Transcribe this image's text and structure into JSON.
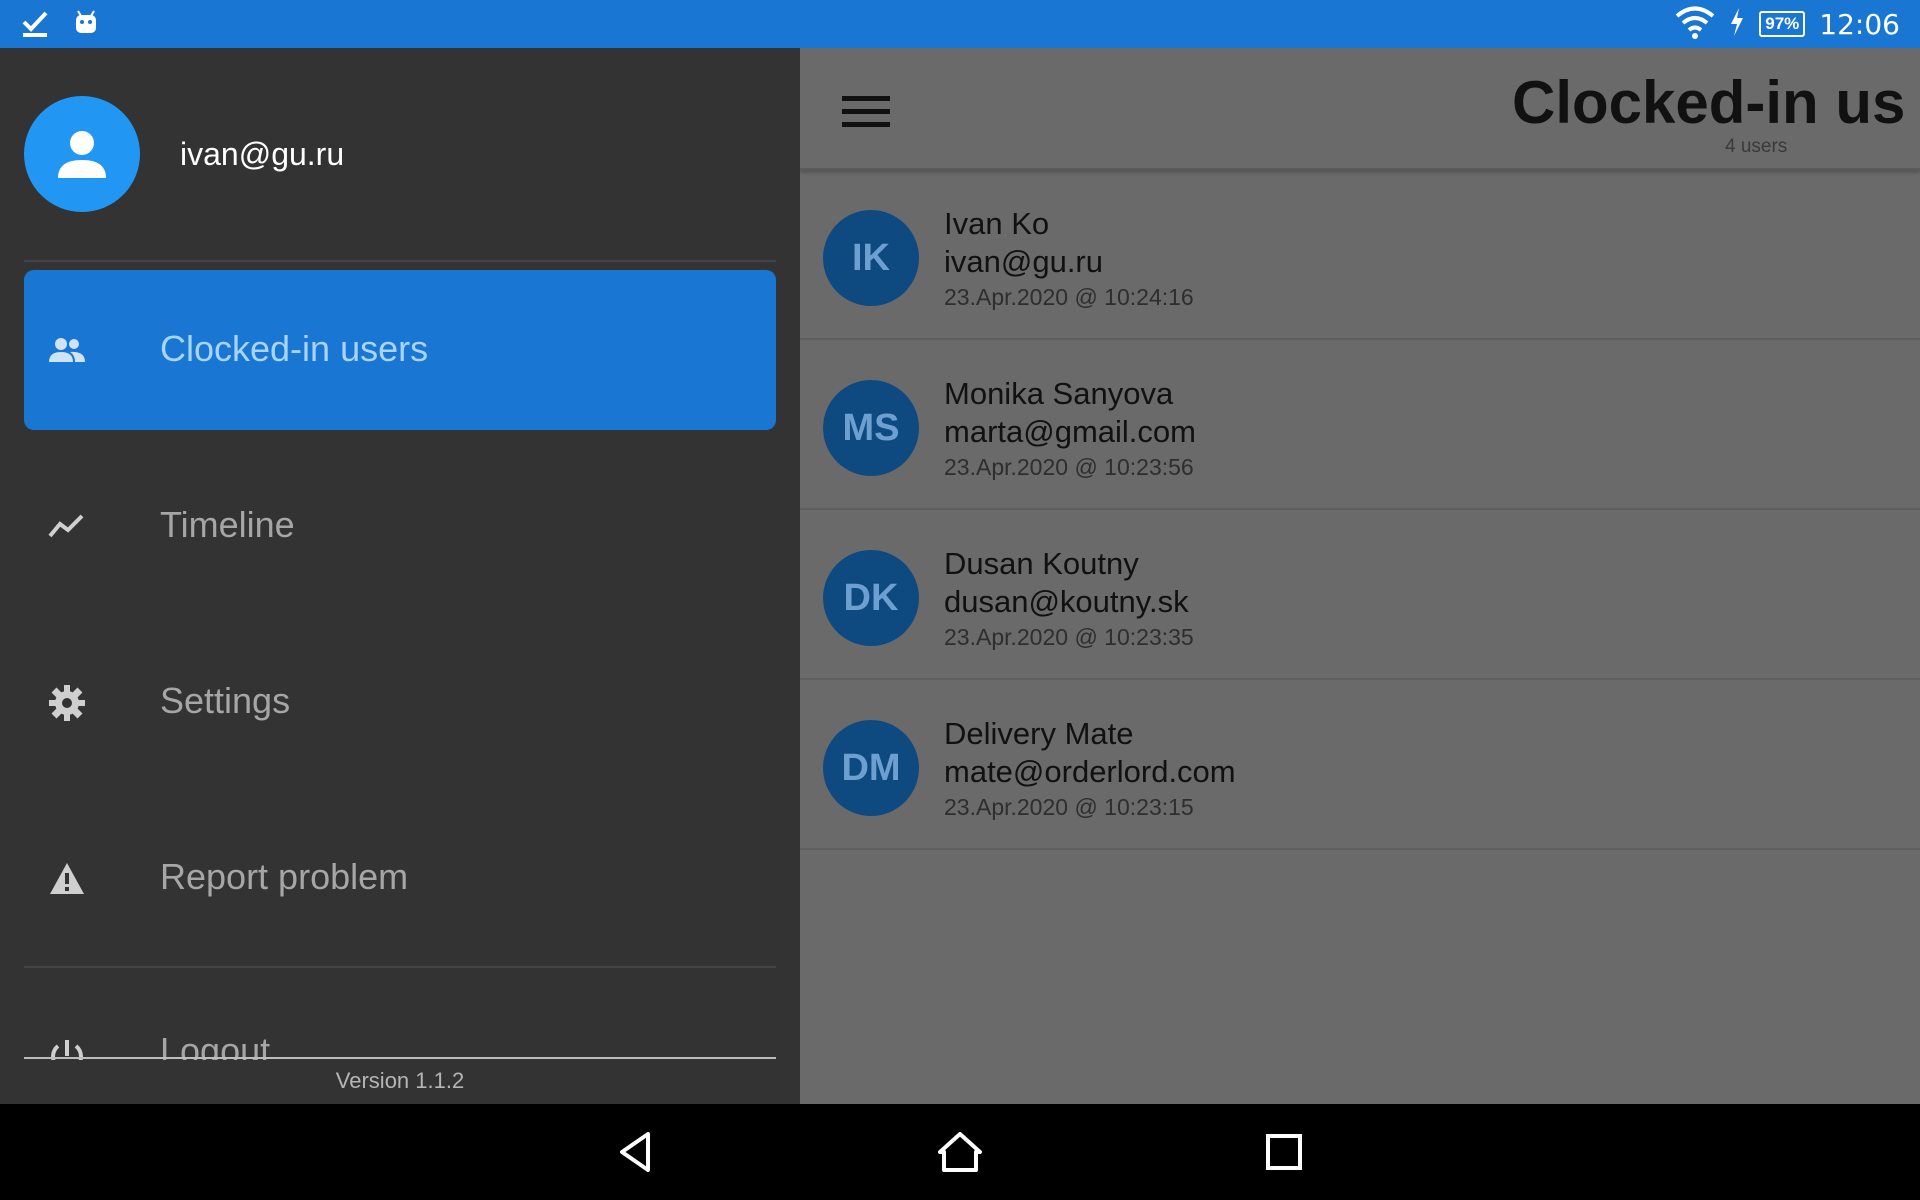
{
  "status_bar": {
    "time": "12:06",
    "battery": "97%",
    "icons": [
      "checkmark-download-icon",
      "android-debug-icon",
      "wifi-icon",
      "charging-bolt-icon",
      "battery-icon"
    ]
  },
  "drawer": {
    "profile_email": "ivan@gu.ru",
    "items": [
      {
        "label": "Clocked-in users",
        "icon": "people-icon",
        "active": true
      },
      {
        "label": "Timeline",
        "icon": "trending-icon",
        "active": false
      },
      {
        "label": "Settings",
        "icon": "gear-icon",
        "active": false
      },
      {
        "label": "Report problem",
        "icon": "warning-icon",
        "active": false
      }
    ],
    "logout_label": "Logout",
    "version": "Version 1.1.2"
  },
  "header": {
    "title": "Clocked-in us",
    "subtitle": "4 users"
  },
  "users": [
    {
      "initials": "IK",
      "name": "Ivan Ko",
      "email": "ivan@gu.ru",
      "time": "23.Apr.2020 @ 10:24:16"
    },
    {
      "initials": "MS",
      "name": "Monika Sanyova",
      "email": "marta@gmail.com",
      "time": "23.Apr.2020 @ 10:23:56"
    },
    {
      "initials": "DK",
      "name": "Dusan Koutny",
      "email": "dusan@koutny.sk",
      "time": "23.Apr.2020 @ 10:23:35"
    },
    {
      "initials": "DM",
      "name": "Delivery Mate",
      "email": "mate@orderlord.com",
      "time": "23.Apr.2020 @ 10:23:15"
    }
  ],
  "colors": {
    "status_bar": "#1976d2",
    "drawer_bg": "#333333",
    "active_item": "#1976d2",
    "avatar": "#2196f3",
    "user_avatar": "#0e4a80"
  }
}
